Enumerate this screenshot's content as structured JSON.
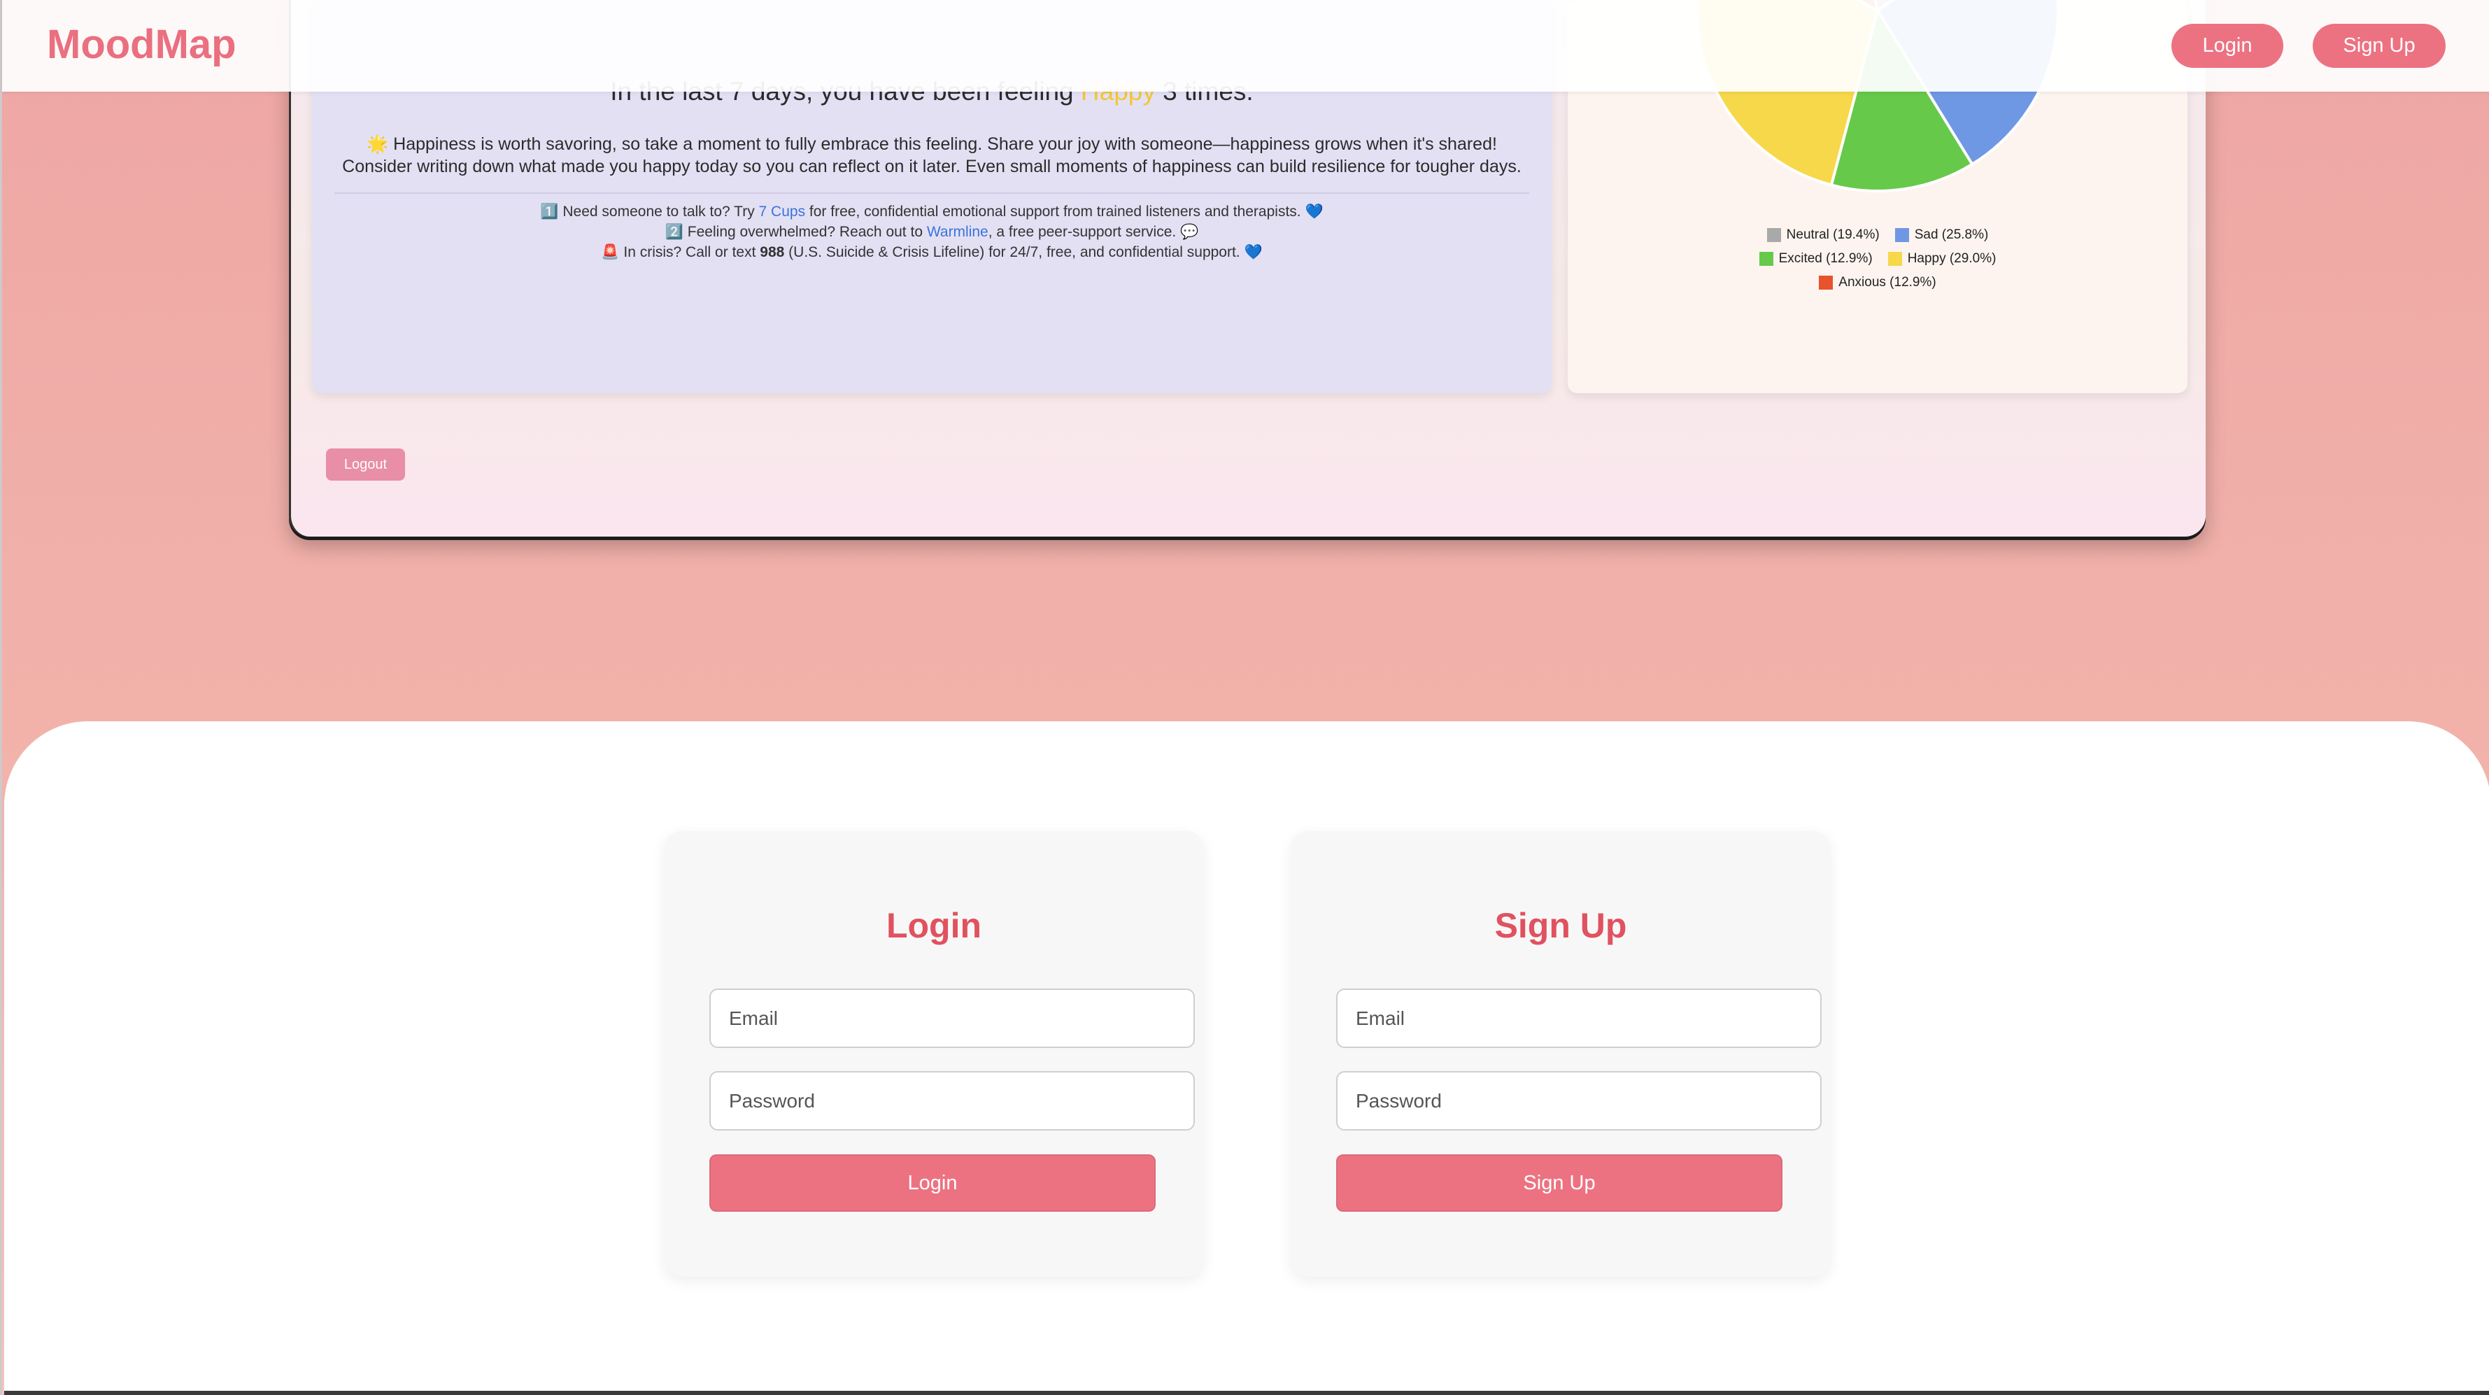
{
  "app": {
    "logo": "MoodMap"
  },
  "nav": {
    "login_label": "Login",
    "signup_label": "Sign Up"
  },
  "insight": {
    "prefix": "In the last 7 days, you have been feeling",
    "mood": "Happy",
    "suffix": "3 times.",
    "message_emoji": "🌟",
    "message": "Happiness is worth savoring, so take a moment to fully embrace this feeling. Share your joy with someone—happiness grows when it's shared! Consider writing down what made you happy today so you can reflect on it later. Even small moments of happiness can build resilience for tougher days.",
    "resources": [
      {
        "emoji": "1️⃣",
        "before": "Need someone to talk to? Try",
        "link": "7 Cups",
        "after": "for free, confidential emotional support from trained listeners and therapists. 💙"
      },
      {
        "emoji": "2️⃣",
        "before": "Feeling overwhelmed? Reach out to",
        "link": "Warmline",
        "after": ", a free peer-support service. 💬"
      },
      {
        "emoji": "🚨",
        "before": "In crisis? Call or text",
        "bold": "988",
        "after": "(U.S. Suicide & Crisis Lifeline) for 24/7, free, and confidential support. 💙"
      }
    ]
  },
  "chart_data": {
    "type": "pie",
    "title": "",
    "series": [
      {
        "name": "Neutral",
        "label": "Neutral (19.4%)",
        "value": 19.4,
        "color": "#a9a9a9"
      },
      {
        "name": "Sad",
        "label": "Sad (25.8%)",
        "value": 25.8,
        "color": "#6f98e4"
      },
      {
        "name": "Excited",
        "label": "Excited (12.9%)",
        "value": 12.9,
        "color": "#66c94a"
      },
      {
        "name": "Happy",
        "label": "Happy (29.0%)",
        "value": 29.0,
        "color": "#f6d84a"
      },
      {
        "name": "Anxious",
        "label": "Anxious (12.9%)",
        "value": 12.9,
        "color": "#e8522d"
      }
    ],
    "legend": "bottom"
  },
  "dashboard": {
    "logout_label": "Logout"
  },
  "auth": {
    "login": {
      "title": "Login",
      "email_placeholder": "Email",
      "password_placeholder": "Password",
      "submit_label": "Login"
    },
    "signup": {
      "title": "Sign Up",
      "email_placeholder": "Email",
      "password_placeholder": "Password",
      "submit_label": "Sign Up"
    }
  }
}
